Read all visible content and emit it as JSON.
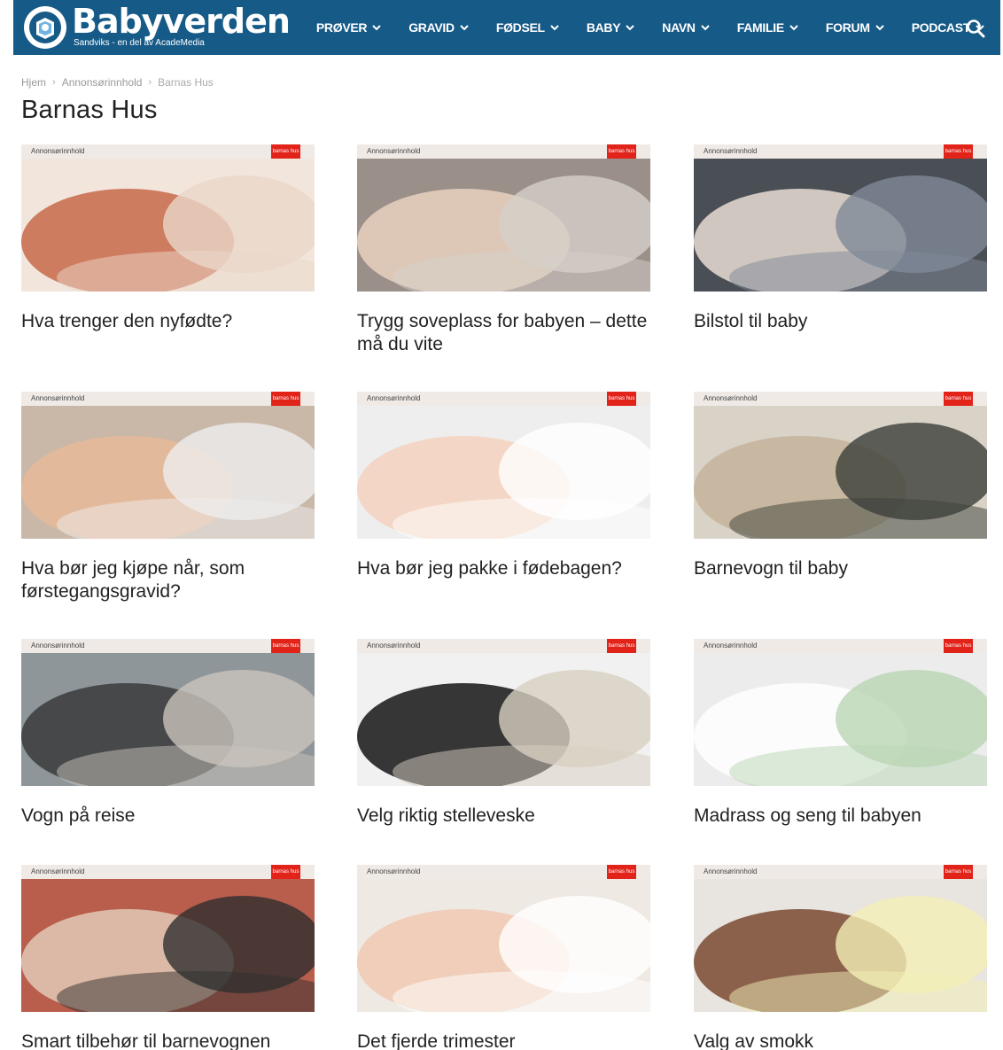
{
  "header": {
    "logo_name": "Babyverden",
    "logo_tagline": "Sandviks - en del av AcadeMedia",
    "nav": [
      {
        "label": "PRØVER"
      },
      {
        "label": "GRAVID"
      },
      {
        "label": "FØDSEL"
      },
      {
        "label": "BABY"
      },
      {
        "label": "NAVN"
      },
      {
        "label": "FAMILIE"
      },
      {
        "label": "FORUM"
      },
      {
        "label": "PODCAST"
      }
    ],
    "icons": {
      "search": "search-icon",
      "dropdown": "chevron-down-icon"
    }
  },
  "breadcrumb": [
    "Hjem",
    "Annonsørinnhold",
    "Barnas Hus"
  ],
  "page_title": "Barnas Hus",
  "ad_label": "Annonsørinnhold",
  "brand_badge": "barnas hus",
  "colors": {
    "header_bg": "#165a87",
    "badge_red": "#e2231a",
    "ad_strip": "#efeae6"
  },
  "articles": [
    {
      "title": "Hva trenger den nyfødte?"
    },
    {
      "title": "Trygg soveplass for babyen – dette må du vite"
    },
    {
      "title": "Bilstol til baby"
    },
    {
      "title": "Hva bør jeg kjøpe når, som førstegangsgravid?"
    },
    {
      "title": "Hva bør jeg pakke i fødebagen?"
    },
    {
      "title": "Barnevogn til baby"
    },
    {
      "title": "Vogn på reise"
    },
    {
      "title": "Velg riktig stelleveske"
    },
    {
      "title": "Madrass og seng til babyen"
    },
    {
      "title": "Smart tilbehør til barnevognen"
    },
    {
      "title": "Det fjerde trimester"
    },
    {
      "title": "Valg av smokk"
    }
  ]
}
